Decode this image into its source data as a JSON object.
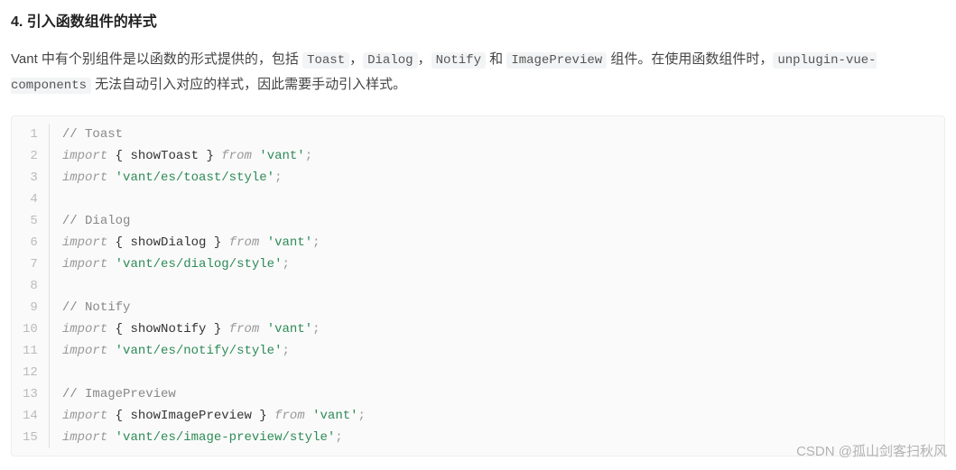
{
  "heading": "4. 引入函数组件的样式",
  "paragraph": {
    "pre": "Vant 中有个别组件是以函数的形式提供的，包括 ",
    "code1": "Toast",
    "sep1": "，",
    "code2": "Dialog",
    "sep2": "，",
    "code3": "Notify",
    "sep3": " 和 ",
    "code4": "ImagePreview",
    "mid": " 组件。在使用函数组件时，",
    "code5": "unplugin-vue-components",
    "post": " 无法自动引入对应的样式，因此需要手动引入样式。"
  },
  "code": {
    "lines": [
      {
        "n": "1",
        "tokens": [
          {
            "t": "// Toast",
            "c": "comment"
          }
        ]
      },
      {
        "n": "2",
        "tokens": [
          {
            "t": "import",
            "c": "keyword"
          },
          {
            "t": " ",
            "c": ""
          },
          {
            "t": "{",
            "c": "brace"
          },
          {
            "t": " showToast ",
            "c": "ident"
          },
          {
            "t": "}",
            "c": "brace"
          },
          {
            "t": " ",
            "c": ""
          },
          {
            "t": "from",
            "c": "keyword"
          },
          {
            "t": " ",
            "c": ""
          },
          {
            "t": "'vant'",
            "c": "string"
          },
          {
            "t": ";",
            "c": "punct"
          }
        ]
      },
      {
        "n": "3",
        "tokens": [
          {
            "t": "import",
            "c": "keyword"
          },
          {
            "t": " ",
            "c": ""
          },
          {
            "t": "'vant/es/toast/style'",
            "c": "string"
          },
          {
            "t": ";",
            "c": "punct"
          }
        ]
      },
      {
        "n": "4",
        "tokens": []
      },
      {
        "n": "5",
        "tokens": [
          {
            "t": "// Dialog",
            "c": "comment"
          }
        ]
      },
      {
        "n": "6",
        "tokens": [
          {
            "t": "import",
            "c": "keyword"
          },
          {
            "t": " ",
            "c": ""
          },
          {
            "t": "{",
            "c": "brace"
          },
          {
            "t": " showDialog ",
            "c": "ident"
          },
          {
            "t": "}",
            "c": "brace"
          },
          {
            "t": " ",
            "c": ""
          },
          {
            "t": "from",
            "c": "keyword"
          },
          {
            "t": " ",
            "c": ""
          },
          {
            "t": "'vant'",
            "c": "string"
          },
          {
            "t": ";",
            "c": "punct"
          }
        ]
      },
      {
        "n": "7",
        "tokens": [
          {
            "t": "import",
            "c": "keyword"
          },
          {
            "t": " ",
            "c": ""
          },
          {
            "t": "'vant/es/dialog/style'",
            "c": "string"
          },
          {
            "t": ";",
            "c": "punct"
          }
        ]
      },
      {
        "n": "8",
        "tokens": []
      },
      {
        "n": "9",
        "tokens": [
          {
            "t": "// Notify",
            "c": "comment"
          }
        ]
      },
      {
        "n": "10",
        "tokens": [
          {
            "t": "import",
            "c": "keyword"
          },
          {
            "t": " ",
            "c": ""
          },
          {
            "t": "{",
            "c": "brace"
          },
          {
            "t": " showNotify ",
            "c": "ident"
          },
          {
            "t": "}",
            "c": "brace"
          },
          {
            "t": " ",
            "c": ""
          },
          {
            "t": "from",
            "c": "keyword"
          },
          {
            "t": " ",
            "c": ""
          },
          {
            "t": "'vant'",
            "c": "string"
          },
          {
            "t": ";",
            "c": "punct"
          }
        ]
      },
      {
        "n": "11",
        "tokens": [
          {
            "t": "import",
            "c": "keyword"
          },
          {
            "t": " ",
            "c": ""
          },
          {
            "t": "'vant/es/notify/style'",
            "c": "string"
          },
          {
            "t": ";",
            "c": "punct"
          }
        ]
      },
      {
        "n": "12",
        "tokens": []
      },
      {
        "n": "13",
        "tokens": [
          {
            "t": "// ImagePreview",
            "c": "comment"
          }
        ]
      },
      {
        "n": "14",
        "tokens": [
          {
            "t": "import",
            "c": "keyword"
          },
          {
            "t": " ",
            "c": ""
          },
          {
            "t": "{",
            "c": "brace"
          },
          {
            "t": " showImagePreview ",
            "c": "ident"
          },
          {
            "t": "}",
            "c": "brace"
          },
          {
            "t": " ",
            "c": ""
          },
          {
            "t": "from",
            "c": "keyword"
          },
          {
            "t": " ",
            "c": ""
          },
          {
            "t": "'vant'",
            "c": "string"
          },
          {
            "t": ";",
            "c": "punct"
          }
        ]
      },
      {
        "n": "15",
        "tokens": [
          {
            "t": "import",
            "c": "keyword"
          },
          {
            "t": " ",
            "c": ""
          },
          {
            "t": "'vant/es/image-preview/style'",
            "c": "string"
          },
          {
            "t": ";",
            "c": "punct"
          }
        ]
      }
    ]
  },
  "watermark": "CSDN @孤山剑客扫秋风"
}
